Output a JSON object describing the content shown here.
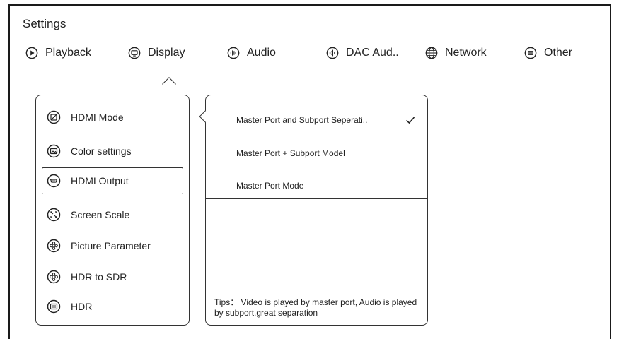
{
  "window": {
    "title": "Settings"
  },
  "tabs": [
    {
      "label": "Playback",
      "icon": "play-icon"
    },
    {
      "label": "Display",
      "icon": "display-icon"
    },
    {
      "label": "Audio",
      "icon": "audio-icon"
    },
    {
      "label": "DAC Aud..",
      "icon": "dac-audio-icon"
    },
    {
      "label": "Network",
      "icon": "globe-icon"
    },
    {
      "label": "Other",
      "icon": "menu-icon"
    }
  ],
  "active_tab": "Display",
  "menu": {
    "items": [
      {
        "label": "HDMI Mode",
        "icon": "hdmi-mode-icon"
      },
      {
        "label": "Color settings",
        "icon": "color-settings-icon"
      },
      {
        "label": "HDMI Output",
        "icon": "hdmi-output-icon"
      },
      {
        "label": "Screen Scale",
        "icon": "screen-scale-icon"
      },
      {
        "label": "Picture Parameter",
        "icon": "picture-parameter-icon"
      },
      {
        "label": "HDR to SDR",
        "icon": "hdr-to-sdr-icon"
      },
      {
        "label": "HDR",
        "icon": "hdr-icon"
      }
    ],
    "selected": "HDMI Output"
  },
  "options": {
    "items": [
      {
        "label": "Master Port and Subport Seperati..",
        "checked": true
      },
      {
        "label": "Master Port + Subport Model",
        "checked": false
      },
      {
        "label": "Master Port Mode",
        "checked": false
      }
    ],
    "tips": "Tips： Video is played by master port, Audio is played by subport,great separation"
  }
}
